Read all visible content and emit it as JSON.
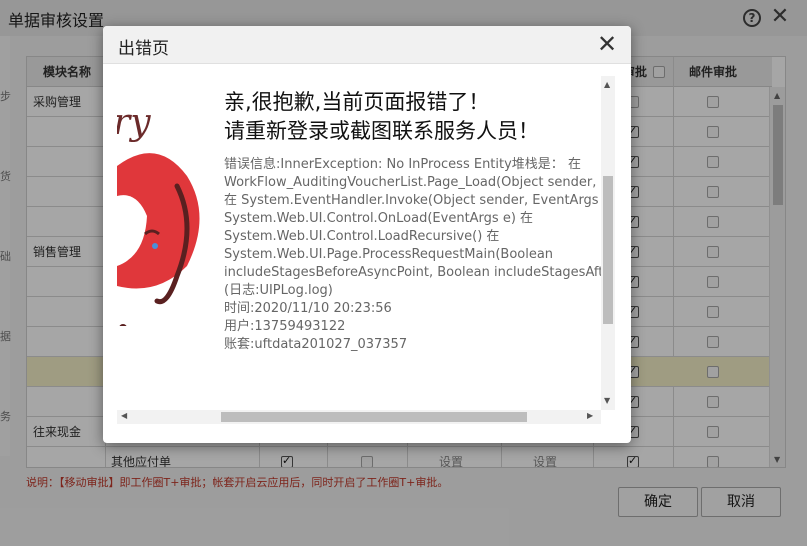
{
  "base_dialog": {
    "title": "单据审核设置",
    "help_glyph": "?",
    "close_glyph": "✕",
    "left_marks": [
      "步",
      "货",
      "础",
      "据",
      "务"
    ],
    "columns": {
      "module": "模块名称",
      "mobile_approve": "审批",
      "mail_approve": "邮件审批"
    },
    "rows": [
      {
        "module": "采购管理",
        "sub": "",
        "mobile": false,
        "mail": false
      },
      {
        "module": "",
        "sub": "",
        "mobile": true,
        "mail": false
      },
      {
        "module": "",
        "sub": "",
        "mobile": true,
        "mail": false
      },
      {
        "module": "",
        "sub": "",
        "mobile": true,
        "mail": false
      },
      {
        "module": "",
        "sub": "",
        "mobile": true,
        "mail": false
      },
      {
        "module": "销售管理",
        "sub": "",
        "mobile": true,
        "mail": false
      },
      {
        "module": "",
        "sub": "",
        "mobile": true,
        "mail": false
      },
      {
        "module": "",
        "sub": "",
        "mobile": true,
        "mail": false
      },
      {
        "module": "",
        "sub": "",
        "mobile": true,
        "mail": false
      },
      {
        "module": "",
        "sub": "",
        "mobile": true,
        "mail": false,
        "selected": true
      },
      {
        "module": "",
        "sub": "",
        "mobile": true,
        "mail": false
      },
      {
        "module": "往来现金",
        "sub": "",
        "mobile": true,
        "mail": false
      },
      {
        "module": "",
        "sub": "其他应付单",
        "mobile": true,
        "mail": false,
        "col1": true,
        "col2": false,
        "set1": "设置",
        "set2": "设置"
      }
    ],
    "note": "说明：【移动审批】即工作圈T+审批；帐套开启云应用后，同时开启了工作圈T+审批。",
    "ok_label": "确定",
    "cancel_label": "取消"
  },
  "error_modal": {
    "title": "出错页",
    "close_glyph": "✕",
    "heading_line1": "亲,很抱歉,当前页面报错了！",
    "heading_line2": "请重新登录或截图联系服务人员！",
    "detail_lines": [
      "错误信息:InnerException: No InProcess Entity堆栈是： 在",
      "WorkFlow_AuditingVoucherList.Page_Load(Object sender, Eve",
      "在 System.EventHandler.Invoke(Object sender, EventArgs e) 在",
      "System.Web.UI.Control.OnLoad(EventArgs e) 在",
      "System.Web.UI.Control.LoadRecursive() 在",
      "System.Web.UI.Page.ProcessRequestMain(Boolean",
      "includeStagesBeforeAsyncPoint, Boolean includeStagesAfterAs",
      "(日志:UIPLog.log)",
      "时间:2020/11/10 20:23:56",
      "用户:13759493122",
      "账套:uftdata201027_037357"
    ],
    "mascot_text": "ry"
  },
  "colors": {
    "accent_red": "#c0392b",
    "mascot_red": "#e0373b",
    "selected_row": "#f5f0c8"
  }
}
